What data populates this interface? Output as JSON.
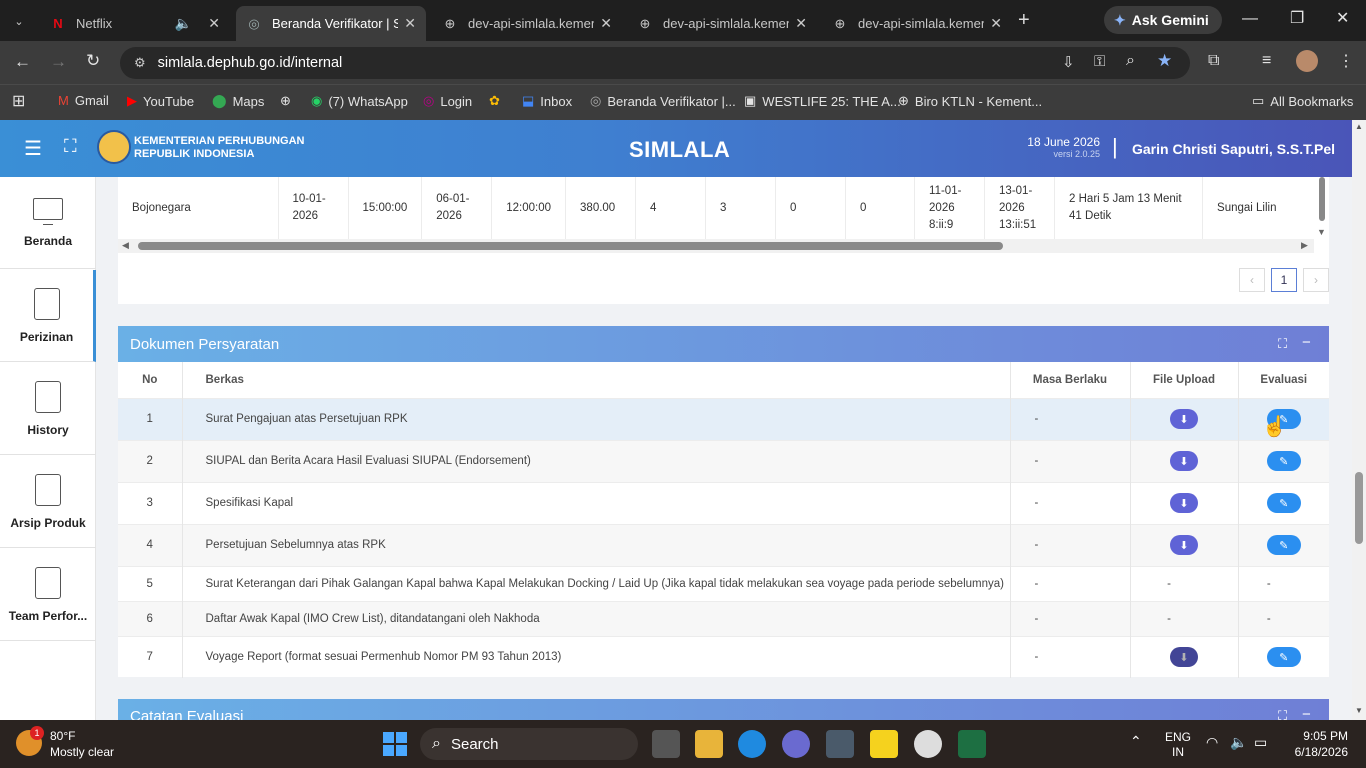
{
  "browser": {
    "tabs": [
      {
        "title": "Netflix",
        "icon": "netflix-icon"
      },
      {
        "title": "Beranda Verifikator | Si",
        "icon": "simlala-icon"
      },
      {
        "title": "dev-api-simlala.kemenh",
        "icon": "globe-icon"
      },
      {
        "title": "dev-api-simlala.kemenh",
        "icon": "globe-icon"
      },
      {
        "title": "dev-api-simlala.kemenh",
        "icon": "globe-icon"
      }
    ],
    "ask_gemini": "Ask Gemini",
    "url": "simlala.dephub.go.id/internal",
    "bookmarks": [
      "Gmail",
      "YouTube",
      "Maps",
      "(7) WhatsApp",
      "Login",
      "Inbox",
      "Beranda Verifikator |...",
      "WESTLIFE 25: THE A...",
      "Biro KTLN - Kement..."
    ],
    "all_bookmarks": "All Bookmarks"
  },
  "app": {
    "org_line1": "KEMENTERIAN PERHUBUNGAN",
    "org_line2": "REPUBLIK INDONESIA",
    "title": "SIMLALA",
    "date": "18 June 2026",
    "version": "versi 2.0.25",
    "separator": "|",
    "user": "Garin Christi Saputri, S.S.T.Pel"
  },
  "sidebar": [
    {
      "label": "Beranda",
      "icon": "monitor-icon"
    },
    {
      "label": "Perizinan",
      "icon": "document-icon"
    },
    {
      "label": "History",
      "icon": "document-icon"
    },
    {
      "label": "Arsip Produk",
      "icon": "document-icon"
    },
    {
      "label": "Team Perfor...",
      "icon": "document-icon"
    }
  ],
  "voyage_row": {
    "cells": [
      "Bojonegara",
      "10-01-\n2026",
      "15:00:00",
      "06-01-\n2026",
      "12:00:00",
      "380.00",
      "4",
      "3",
      "0",
      "0",
      "11-01-\n2026\n8:ii:9",
      "13-01-\n2026\n13:ii:51",
      "2 Hari 5 Jam 13 Menit\n41 Detik",
      "Sungai Lilin"
    ]
  },
  "pagination": {
    "prev": "‹",
    "page": "1",
    "next": "›"
  },
  "dokumen": {
    "title": "Dokumen Persyaratan",
    "headers": {
      "no": "No",
      "berkas": "Berkas",
      "masa": "Masa Berlaku",
      "upload": "File Upload",
      "evaluasi": "Evaluasi"
    },
    "rows": [
      {
        "no": "1",
        "berkas": "Surat Pengajuan atas Persetujuan RPK",
        "masa": "-",
        "upload": true,
        "evaluasi": true
      },
      {
        "no": "2",
        "berkas": "SIUPAL dan Berita Acara Hasil Evaluasi SIUPAL (Endorsement)",
        "masa": "-",
        "upload": true,
        "evaluasi": true
      },
      {
        "no": "3",
        "berkas": "Spesifikasi Kapal",
        "masa": "-",
        "upload": true,
        "evaluasi": true
      },
      {
        "no": "4",
        "berkas": "Persetujuan Sebelumnya atas RPK",
        "masa": "-",
        "upload": true,
        "evaluasi": true
      },
      {
        "no": "5",
        "berkas": "Surat Keterangan dari Pihak Galangan Kapal bahwa Kapal Melakukan Docking / Laid Up (Jika kapal tidak melakukan sea voyage pada periode sebelumnya)",
        "masa": "-",
        "upload": false,
        "evaluasi": false,
        "dash": "-"
      },
      {
        "no": "6",
        "berkas": "Daftar Awak Kapal (IMO Crew List), ditandatangani oleh Nakhoda",
        "masa": "-",
        "upload": false,
        "evaluasi": false,
        "dash": "-"
      },
      {
        "no": "7",
        "berkas": "Voyage Report (format sesuai Permenhub Nomor PM 93 Tahun 2013)",
        "masa": "-",
        "upload": true,
        "evaluasi": true
      }
    ]
  },
  "catatan": {
    "title": "Catatan Evaluasi"
  },
  "taskbar": {
    "temp": "80°F",
    "weather": "Mostly clear",
    "badge": "1",
    "search": "Search",
    "lang1": "ENG",
    "lang2": "IN",
    "time": "9:05 PM",
    "date": "6/18/2026"
  },
  "colors": {
    "header_start": "#3a8fd6",
    "header_end": "#4a55b8",
    "download_btn": "#5f63d6",
    "edit_btn": "#2b8ff0"
  }
}
